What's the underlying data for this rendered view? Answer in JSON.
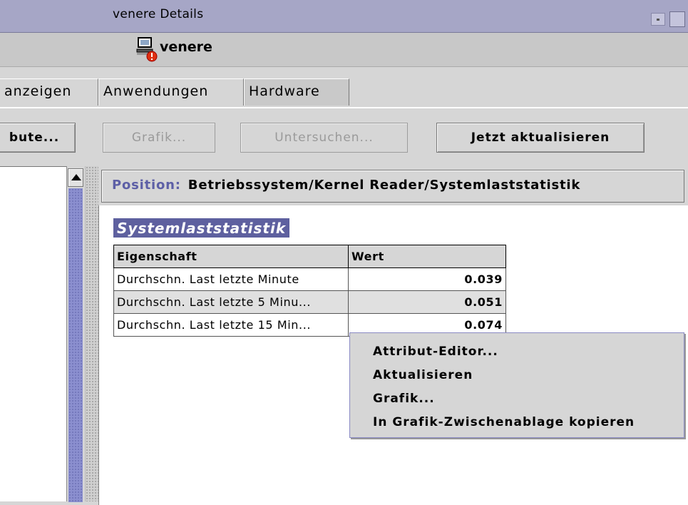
{
  "window": {
    "title": "venere Details"
  },
  "header": {
    "host_icon": "computer-alarm-icon",
    "host_name": "venere"
  },
  "tabs": [
    {
      "label": "anzeigen"
    },
    {
      "label": "Anwendungen"
    },
    {
      "label": "Hardware"
    }
  ],
  "toolbar": {
    "attribute_label": "bute...",
    "grafik_label": "Grafik...",
    "untersuchen_label": "Untersuchen...",
    "refresh_label": "Jetzt aktualisieren"
  },
  "position": {
    "label": "Position:",
    "path": "Betriebssystem/Kernel Reader/Systemlaststatistik"
  },
  "section": {
    "title": "Systemlaststatistik"
  },
  "table": {
    "headers": [
      "Eigenschaft",
      "Wert"
    ],
    "rows": [
      {
        "property": "Durchschn. Last letzte Minute",
        "value": "0.039"
      },
      {
        "property": "Durchschn. Last letzte 5 Minu...",
        "value": "0.051"
      },
      {
        "property": "Durchschn. Last letzte 15 Min...",
        "value": "0.074"
      }
    ]
  },
  "context_menu": {
    "items": [
      {
        "label": "Attribut-Editor..."
      },
      {
        "label": "Aktualisieren"
      },
      {
        "label": "Grafik..."
      },
      {
        "label": "In Grafik-Zwischenablage kopieren"
      }
    ]
  },
  "colors": {
    "titlebar": "#a6a6c6",
    "accent": "#5e609f",
    "scroll_thumb": "#8b8fcf"
  }
}
